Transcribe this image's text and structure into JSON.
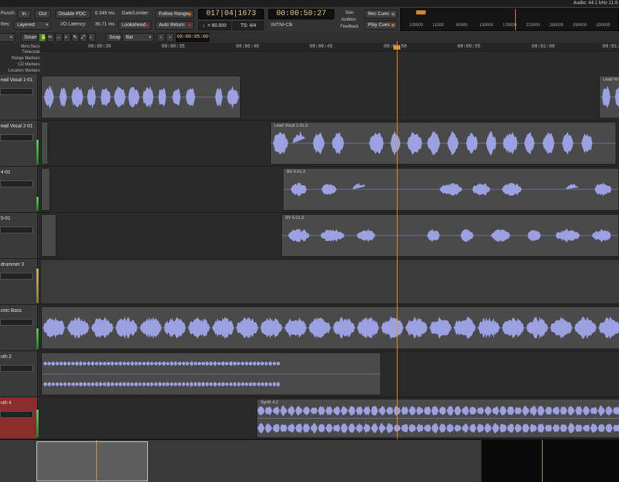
{
  "header": {
    "audio_info": "Audio: 44.1 kHz 11.6"
  },
  "toolbar": {
    "punch_label": "Punch:",
    "in_label": "In",
    "out_label": "Out",
    "rec_label": "Rec:",
    "rec_mode": "Layered",
    "disable_pdc": "Disable PDC",
    "pdc_value": "6.349 ms",
    "io_latency_label": "I/O Latency:",
    "io_latency_value": "36.71 ms",
    "gate_limiter": "Gate/Limiter:",
    "lookahead": "Lookahead",
    "follow_range": "Follow Range",
    "auto_return": "Auto Return",
    "bbt_counter": "017|04|1673",
    "time_counter": "00:00:50:27",
    "tempo": "♩= 80.000",
    "time_signature": "TS: 4/4",
    "sync_source": "INT/M-Clk",
    "solo": "Solo",
    "audition": "Audition",
    "feedback": "Feedback",
    "rec_cues": "Rec Cues",
    "play_cues": "Play Cues",
    "mini_ruler_ticks": [
      "100000",
      "11000",
      "90000",
      "130000",
      "170000",
      "210000",
      "250000",
      "290000",
      "330000"
    ]
  },
  "editbar": {
    "tool_mode": "Smart",
    "snap_label": "Snap",
    "grid_value": "Bar",
    "nudge_value": "00:00:05:00"
  },
  "ruler": {
    "labels": [
      "Mins:Secs",
      "Timecode",
      "Range Markers",
      "CD Markers",
      "Location Markers"
    ],
    "ticks": [
      "00:00:30",
      "00:00:35",
      "00:00:40",
      "00:00:45",
      "00:00:50",
      "00:00:55",
      "00:01:00",
      "00:01:0"
    ]
  },
  "tracks": [
    {
      "name": "ead Vocal 1-01",
      "clips": [
        {
          "label": ""
        },
        {
          "label": "Lead Vo"
        }
      ]
    },
    {
      "name": "ead Vocal 2-01",
      "clips": [
        {
          "label": ""
        },
        {
          "label": "Lead Vocal 2-01.3"
        }
      ]
    },
    {
      "name": "4-01",
      "clips": [
        {
          "label": ""
        },
        {
          "label": "BV 4-01.3"
        }
      ]
    },
    {
      "name": "5-01",
      "clips": [
        {
          "label": ""
        },
        {
          "label": "BV 5-01.3"
        }
      ]
    },
    {
      "name": "drummer 3",
      "clips": []
    },
    {
      "name": "ctric Bass",
      "clips": [
        {
          "label": ""
        }
      ]
    },
    {
      "name": "nth 2",
      "clips": [
        {
          "label": ""
        }
      ]
    },
    {
      "name": "nth 4",
      "clips": [
        {
          "label": "Synth 4.2"
        }
      ]
    }
  ],
  "colors": {
    "waveform": "#9aa0e0",
    "playhead": "#e0952c",
    "selected_track": "#8a2d2d"
  }
}
